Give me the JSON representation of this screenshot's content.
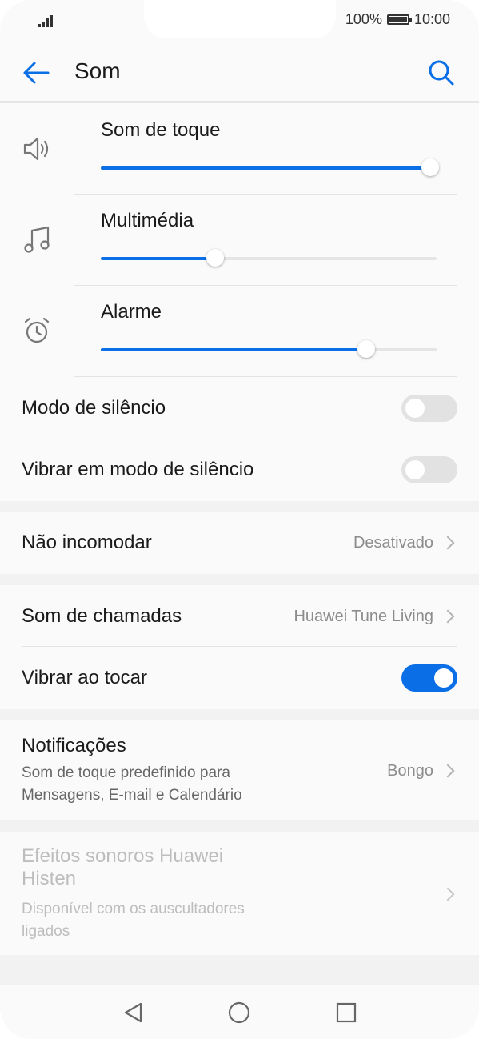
{
  "status_bar": {
    "battery": "100%",
    "time": "10:00"
  },
  "header": {
    "title": "Som"
  },
  "volumes": [
    {
      "label": "Som de toque",
      "level": 0.98,
      "icon": "speaker-icon"
    },
    {
      "label": "Multimédia",
      "level": 0.34,
      "icon": "music-note-icon"
    },
    {
      "label": "Alarme",
      "level": 0.79,
      "icon": "alarm-clock-icon"
    }
  ],
  "silent_mode": {
    "label": "Modo de silêncio",
    "on": false
  },
  "vibrate_silent": {
    "label": "Vibrar em modo de silêncio",
    "on": false
  },
  "dnd": {
    "label": "Não incomodar",
    "value": "Desativado"
  },
  "ringtone": {
    "label": "Som de chamadas",
    "value": "Huawei Tune Living"
  },
  "vibrate_touch": {
    "label": "Vibrar ao tocar",
    "on": true
  },
  "notifications": {
    "label": "Notificações",
    "desc1": "Som de toque predefinido para",
    "desc2": "Mensagens, E-mail e Calendário",
    "value": "Bongo"
  },
  "histen": {
    "label1": "Efeitos sonoros Huawei",
    "label2": "Histen",
    "desc1": "Disponível com os auscultadores",
    "desc2": "ligados"
  },
  "colors": {
    "accent": "#0a6fe6",
    "background": "#f2f2f2",
    "surface": "#fafafa"
  }
}
